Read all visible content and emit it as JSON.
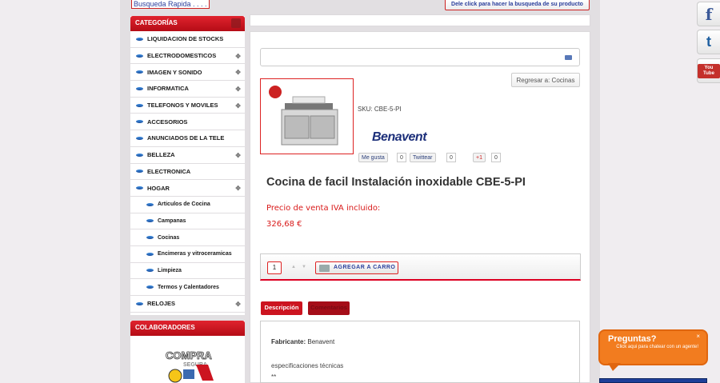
{
  "search": {
    "placeholder": "Busqueda Rapida . . . .",
    "button_label": "Dele click para hacer la busqueda de su producto"
  },
  "sidebar": {
    "title": "CATEGORÍAS",
    "items": [
      {
        "label": "LIQUIDACION DE STOCKS",
        "expandable": false
      },
      {
        "label": "ELECTRODOMESTICOS",
        "expandable": true
      },
      {
        "label": "IMAGEN Y SONIDO",
        "expandable": true
      },
      {
        "label": "INFORMATICA",
        "expandable": true
      },
      {
        "label": "TELEFONOS Y MOVILES",
        "expandable": true
      },
      {
        "label": "ACCESORIOS",
        "expandable": false
      },
      {
        "label": "ANUNCIADOS DE LA TELE",
        "expandable": false
      },
      {
        "label": "BELLEZA",
        "expandable": true
      },
      {
        "label": "ELECTRONICA",
        "expandable": false
      },
      {
        "label": "HOGAR",
        "expandable": true
      },
      {
        "label": "Articulos de Cocina",
        "sub": true
      },
      {
        "label": "Campanas",
        "sub": true
      },
      {
        "label": "Cocinas",
        "sub": true
      },
      {
        "label": "Encimeras y vitroceramicas",
        "sub": true
      },
      {
        "label": "Limpieza",
        "sub": true
      },
      {
        "label": "Termos y Calentadores",
        "sub": true
      },
      {
        "label": "RELOJES",
        "expandable": true
      }
    ],
    "colaboradores_title": "COLABORADORES",
    "compra_logo": "COMPRA SEGURA"
  },
  "product": {
    "back_button": "Regresar a: Cocinas",
    "sku": "SKU: CBE-5-PI",
    "brand": "Benavent",
    "title": "Cocina de facil Instalación inoxidable CBE-5-PI",
    "price_label": "Precio de venta IVA incluido:",
    "price": "326,68 €",
    "quantity": "1",
    "add_to_cart": "AGREGAR A CARRO"
  },
  "social_share": {
    "fb_label": "Me gusta",
    "fb_count": "0",
    "tw_label": "Twittear",
    "tw_count": "0",
    "gplus_label": "+1",
    "gplus_count": "0"
  },
  "tabs": [
    {
      "label": "Descripción"
    },
    {
      "label": "Comentarios"
    }
  ],
  "description": {
    "manufacturer_label": "Fabricante:",
    "manufacturer": "Benavent",
    "specs": "especificaciones técnicas",
    "stars": "**"
  },
  "chat": {
    "title": "Preguntas?",
    "text": "Click aqui para chatear con un agente!",
    "close": "×"
  },
  "side_social": {
    "facebook": "f",
    "twitter": "t",
    "youtube": "You Tube"
  },
  "colors": {
    "accent": "#cc1420",
    "link": "#2a3e9c",
    "chat": "#f27c1f"
  }
}
